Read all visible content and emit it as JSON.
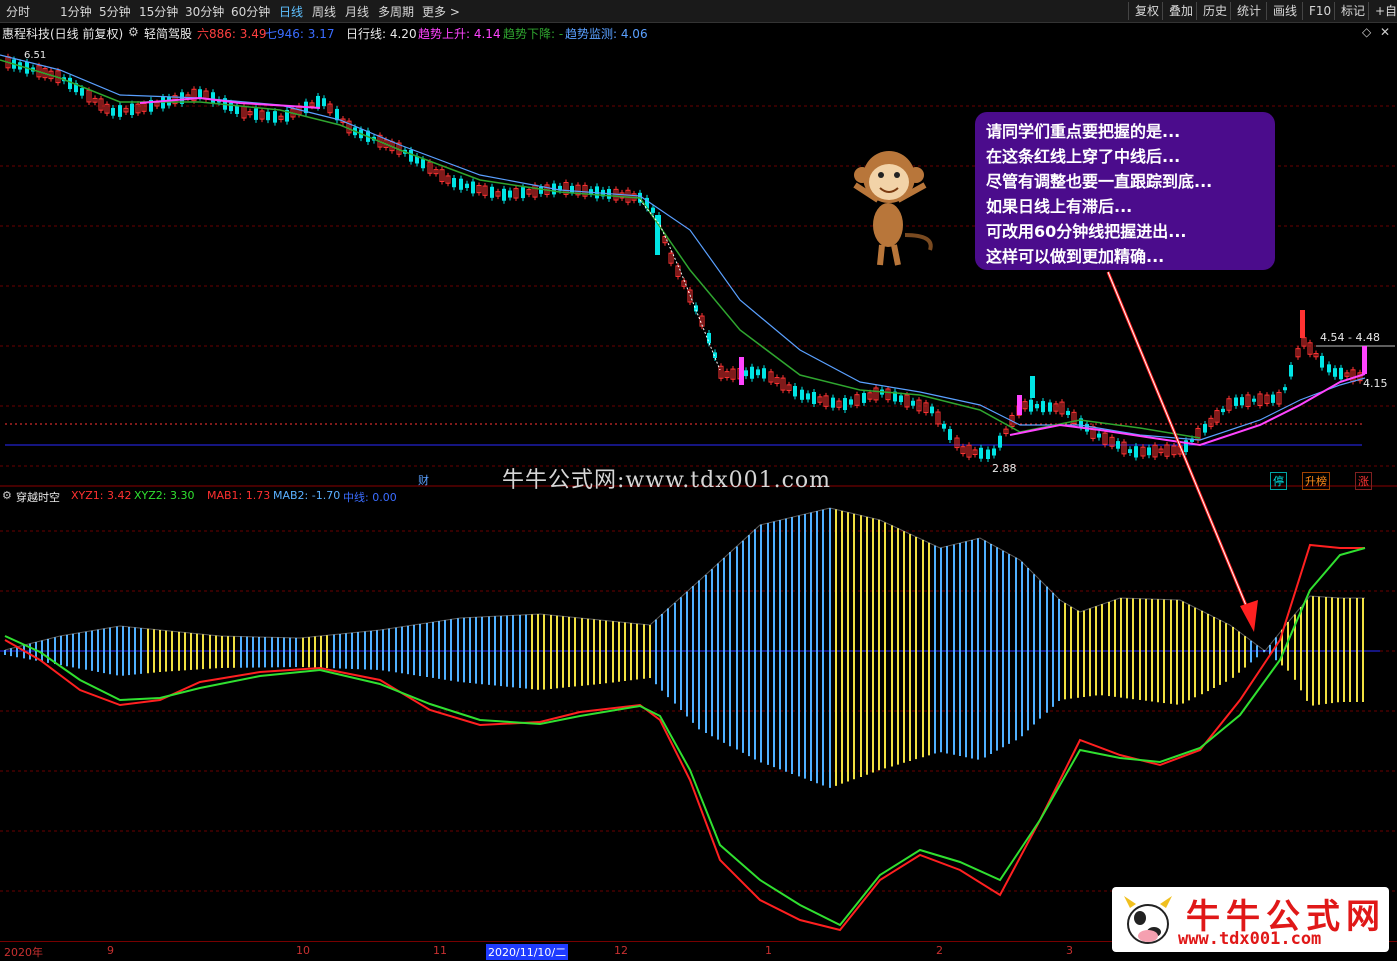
{
  "toolbar": {
    "periods": [
      "分时",
      "1分钟",
      "5分钟",
      "15分钟",
      "30分钟",
      "60分钟",
      "日线",
      "周线",
      "月线",
      "多周期",
      "更多 >"
    ],
    "active_period": "日线",
    "right_buttons": [
      "复权",
      "叠加",
      "历史",
      "统计",
      "画线",
      "F10",
      "标记",
      "+自选"
    ]
  },
  "main_info": {
    "stock": "惠程科技(日线 前复权)",
    "formula": "轻简驾股",
    "six_label": "六886: 3.49",
    "seven_label": "七946: 3.17",
    "daily_line": "日行线: 4.20",
    "trend_up": "趋势上升: 4.14",
    "trend_down": "趋势下降: -",
    "trend_watch": "趋势监测: 4.06"
  },
  "price_labels": {
    "high_left": "6.51",
    "low": "2.88",
    "right_top": "4.54 - 4.48",
    "right_last": "4.15"
  },
  "event_marks": [
    "财",
    "停",
    "升榜",
    "涨"
  ],
  "indicator": {
    "name": "穿越时空",
    "xyz1": "XYZ1: 3.42",
    "xyz2": "XYZ2: 3.30",
    "mab1": "MAB1: 1.73",
    "mab2": "MAB2: -1.70",
    "midline": "中线: 0.00"
  },
  "annotation": {
    "lines": [
      "请同学们重点要把握的是...",
      "在这条红线上穿了中线后...",
      "尽管有调整也要一直跟踪到底...",
      "如果日线上有滞后...",
      "可改用60分钟线把握进出...",
      "这样可以做到更加精确..."
    ]
  },
  "date_axis": [
    "2020年",
    "9",
    "10",
    "11",
    "2020/11/10/二",
    "12",
    "1",
    "2",
    "3"
  ],
  "watermark": "牛牛公式网:www.tdx001.com",
  "logo": {
    "title": "牛牛公式网",
    "url": "www.tdx001.com"
  },
  "colors": {
    "up": "#ff3333",
    "down": "#00e5e5",
    "ma_green": "#2fa52f",
    "ma_blue": "#5aa0ff",
    "ma_magenta": "#ff44ff",
    "bar_blue": "#4fb0ff",
    "bar_yellow": "#f0e040",
    "xyz_red": "#ff2020",
    "xyz_green": "#30e030"
  }
}
